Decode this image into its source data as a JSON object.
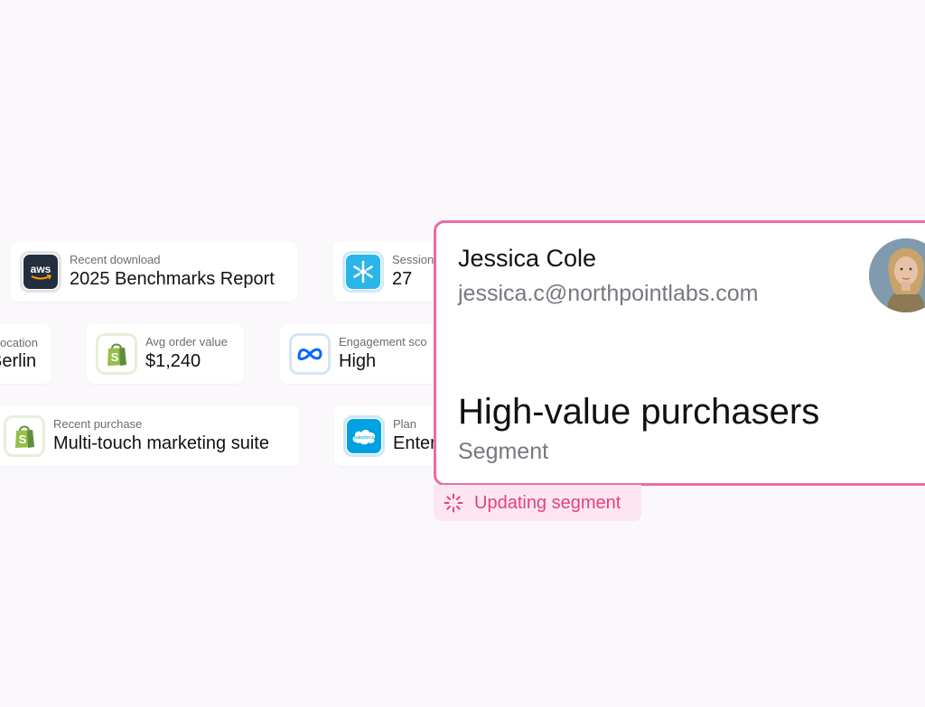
{
  "attribute_cards": [
    {
      "label": "Recent download",
      "value": "2025 Benchmarks Report",
      "icon": "aws-logo-icon"
    },
    {
      "label": "Session",
      "value": "27",
      "icon": "snowflake-logo-icon"
    },
    {
      "label": "ocation",
      "value": "Berlin"
    },
    {
      "label": "Avg order value",
      "value": "$1,240",
      "icon": "shopify-logo-icon"
    },
    {
      "label": "Engagement sco",
      "value": "High",
      "icon": "meta-logo-icon"
    },
    {
      "label": "Recent purchase",
      "value": "Multi-touch marketing suite",
      "icon": "shopify-logo-icon"
    },
    {
      "label": "Plan",
      "value": "Enter",
      "icon": "salesforce-logo-icon"
    }
  ],
  "logos": {
    "aws_text": "aws",
    "salesforce_text": "salesforce"
  },
  "profile": {
    "name": "Jessica Cole",
    "email": "jessica.c@northpointlabs.com",
    "segment": "High-value purchasers",
    "segment_caption": "Segment"
  },
  "status": {
    "text": "Updating segment"
  },
  "colors": {
    "background": "#faf8fb",
    "accent_pink": "#ec6aa8",
    "status_text": "#e4407f",
    "status_bg": "#fde6f0"
  }
}
